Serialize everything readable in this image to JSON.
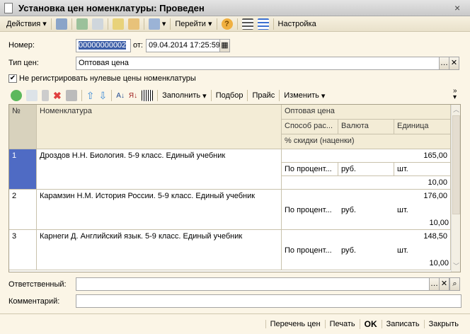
{
  "window": {
    "title": "Установка цен номенклатуры: Проведен",
    "close": "×"
  },
  "toolbar": {
    "actions": "Действия",
    "goto": "Перейти",
    "settings": "Настройка"
  },
  "form": {
    "number_label": "Номер:",
    "number_value": "00000000002",
    "date_label": "от:",
    "date_value": "09.04.2014 17:25:59",
    "price_type_label": "Тип цен:",
    "price_type_value": "Оптовая цена",
    "checkbox_label": "Не регистрировать нулевые цены номенклатуры",
    "checkbox_checked": true
  },
  "table_toolbar": {
    "fill": "Заполнить",
    "select": "Подбор",
    "price": "Прайс",
    "change": "Изменить"
  },
  "table": {
    "headers": {
      "num": "№",
      "item": "Номенклатура",
      "group": "Оптовая цена",
      "method": "Способ рас...",
      "currency": "Валюта",
      "unit": "Единица",
      "discount": "% скидки (наценки)"
    },
    "rows": [
      {
        "num": "1",
        "item": "Дроздов Н.Н. Биология. 5-9 класс. Единый учебник",
        "price": "165,00",
        "method": "По процент...",
        "currency": "руб.",
        "unit": "шт.",
        "discount": "10,00"
      },
      {
        "num": "2",
        "item": "Карамзин Н.М. История России. 5-9 класс. Единый учебник",
        "price": "176,00",
        "method": "По процент...",
        "currency": "руб.",
        "unit": "шт.",
        "discount": "10,00"
      },
      {
        "num": "3",
        "item": "Карнеги Д. Английский язык. 5-9 класс. Единый учебник",
        "price": "148,50",
        "method": "По процент...",
        "currency": "руб.",
        "unit": "шт.",
        "discount": "10,00"
      }
    ]
  },
  "footer_fields": {
    "responsible_label": "Ответственный:",
    "responsible_value": "",
    "comment_label": "Комментарий:",
    "comment_value": ""
  },
  "bottom": {
    "price_list": "Перечень цен",
    "print": "Печать",
    "ok": "OK",
    "save": "Записать",
    "close": "Закрыть"
  }
}
